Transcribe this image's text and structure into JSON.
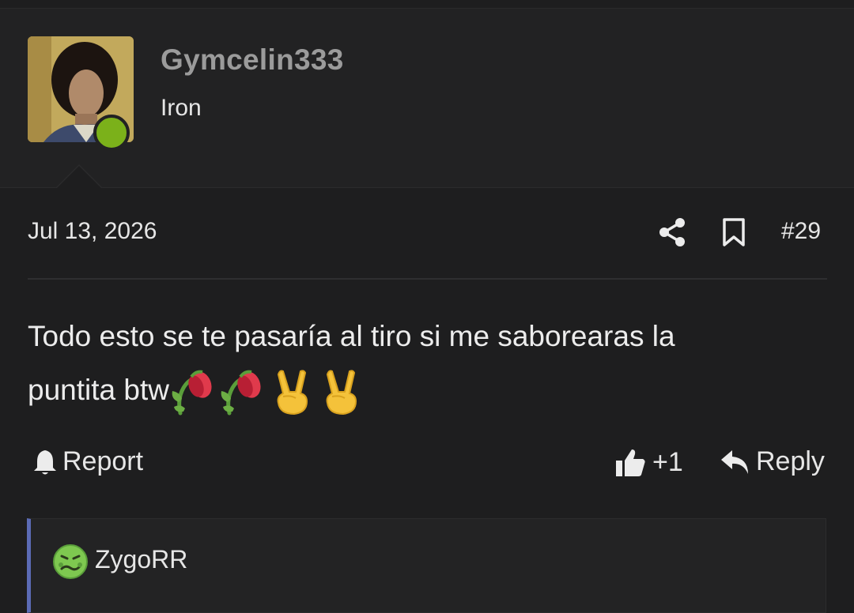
{
  "post": {
    "author": {
      "username": "Gymcelin333",
      "rank": "Iron",
      "avatar_icon": "avatar-photo",
      "online_status_color": "#7bb11a"
    },
    "date": "Jul 13, 2026",
    "number": "#29",
    "message": {
      "text_line1": "Todo esto se te pasaría al tiro si me saborearas la",
      "text_line2": "puntita btw",
      "emojis": [
        "wilted-flower",
        "wilted-flower",
        "victory-hand",
        "victory-hand"
      ]
    },
    "actions": {
      "report_label": "Report",
      "like_count": "+1",
      "reply_label": "Reply"
    },
    "reactions": {
      "user": "ZygoRR",
      "reaction_icon": "nauseated-face"
    }
  },
  "colors": {
    "background": "#1e1e1f",
    "header_bg": "#222223",
    "username": "#9b9b9b",
    "quote_accent": "#5b6bb5"
  }
}
